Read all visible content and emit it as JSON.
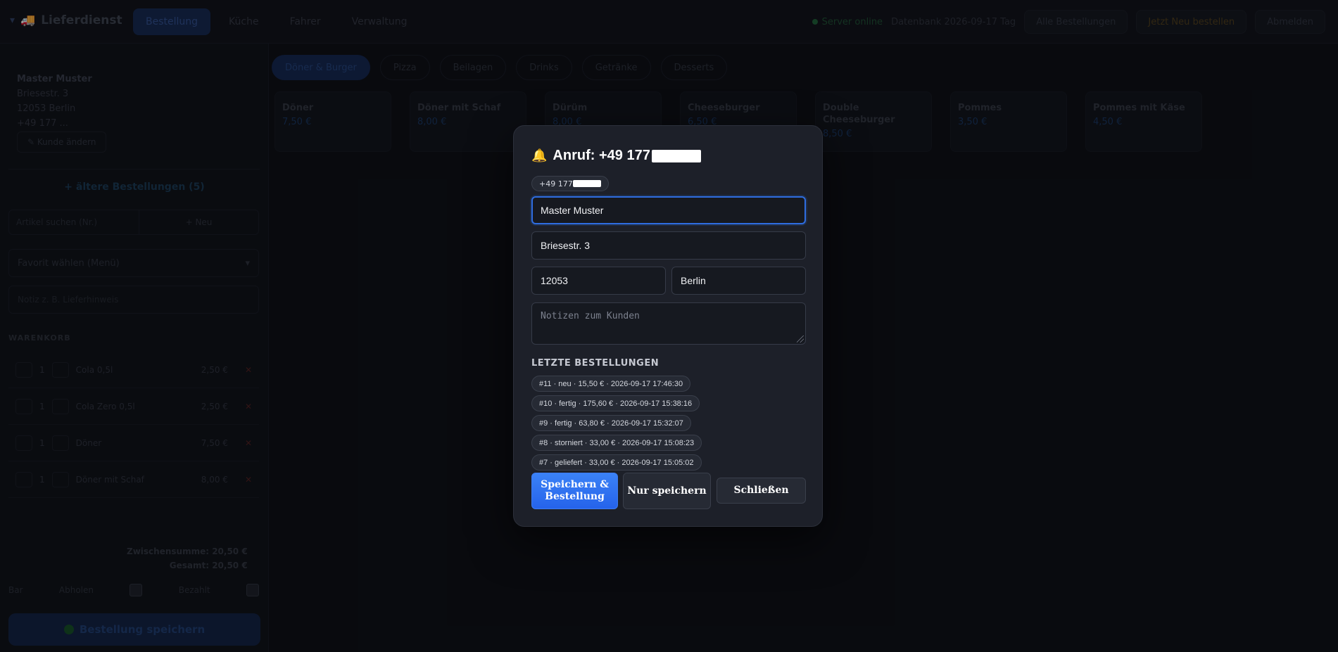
{
  "app": {
    "brand": "Lieferdienst",
    "nav": [
      {
        "label": "Bestellung",
        "active": true
      },
      {
        "label": "Küche"
      },
      {
        "label": "Fahrer"
      },
      {
        "label": "Verwaltung"
      }
    ],
    "status": {
      "online": "Server online",
      "date": "Datenbank 2026-09-17 Tag"
    },
    "top_buttons": [
      "Alle Bestellungen",
      "Jetzt Neu bestellen",
      "Abmelden"
    ]
  },
  "sidebar": {
    "customer_name": "Master Muster",
    "customer_street": "Briesestr. 3",
    "customer_city": "12053 Berlin",
    "customer_phone": "+49 177 ...",
    "edit_button": "✎ Kunde ändern",
    "older_orders": "+ ältere Bestellungen (5)",
    "search_placeholder": "Artikel suchen (Nr.)",
    "new_button": "+ Neu",
    "favorites": "Favorit wählen (Menü)",
    "note_placeholder": "Notiz z. B. Lieferhinweis",
    "cart_header": "WARENKORB",
    "cart": [
      {
        "name": "Cola 0,5l",
        "price": "2,50 €"
      },
      {
        "name": "Cola Zero 0,5l",
        "price": "2,50 €"
      },
      {
        "name": "Döner",
        "price": "7,50 €"
      },
      {
        "name": "Döner mit Schaf",
        "price": "8,00 €"
      }
    ],
    "subtotal": "Zwischensumme: 20,50 €",
    "total": "Gesamt: 20,50 €",
    "options": [
      "Bar",
      "Abholen",
      "Bezahlt"
    ],
    "save_button": "Bestellung speichern"
  },
  "categories": [
    {
      "label": "Döner & Burger",
      "active": true
    },
    {
      "label": "Pizza"
    },
    {
      "label": "Beilagen"
    },
    {
      "label": "Drinks"
    },
    {
      "label": "Getränke"
    },
    {
      "label": "Desserts"
    }
  ],
  "products": [
    {
      "name": "Döner",
      "price": "7,50 €"
    },
    {
      "name": "Döner mit Schaf",
      "price": "8,00 €"
    },
    {
      "name": "Dürüm",
      "price": "8,00 €"
    },
    {
      "name": "Cheeseburger",
      "price": "6,50 €"
    },
    {
      "name": "Double Cheeseburger",
      "price": "8,50 €"
    },
    {
      "name": "Pommes",
      "price": "3,50 €"
    },
    {
      "name": "Pommes mit Käse",
      "price": "4,50 €"
    }
  ],
  "dialog": {
    "icon": "bell-icon",
    "title_prefix": "Anruf: +49 177",
    "phone_pill_prefix": "+49 177",
    "name_value": "Master Muster",
    "street_value": "Briesestr. 3",
    "zip_value": "12053",
    "city_value": "Berlin",
    "notes_placeholder": "Notizen zum Kunden",
    "orders_header": "LETZTE BESTELLUNGEN",
    "orders": [
      "#11 · neu · 15,50 € · 2026-09-17 17:46:30",
      "#10 · fertig · 175,60 € · 2026-09-17 15:38:16",
      "#9 · fertig · 63,80 € · 2026-09-17 15:32:07",
      "#8 · storniert · 33,00 € · 2026-09-17 15:08:23",
      "#7 · geliefert · 33,00 € · 2026-09-17 15:05:02"
    ],
    "save_order_button": "Speichern & Bestellung",
    "save_only_button": "Nur speichern",
    "close_button": "Schließen"
  },
  "colors": {
    "accent": "#3b82f6",
    "modal_bg": "#1d2029",
    "page_bg": "#0b0d12"
  }
}
